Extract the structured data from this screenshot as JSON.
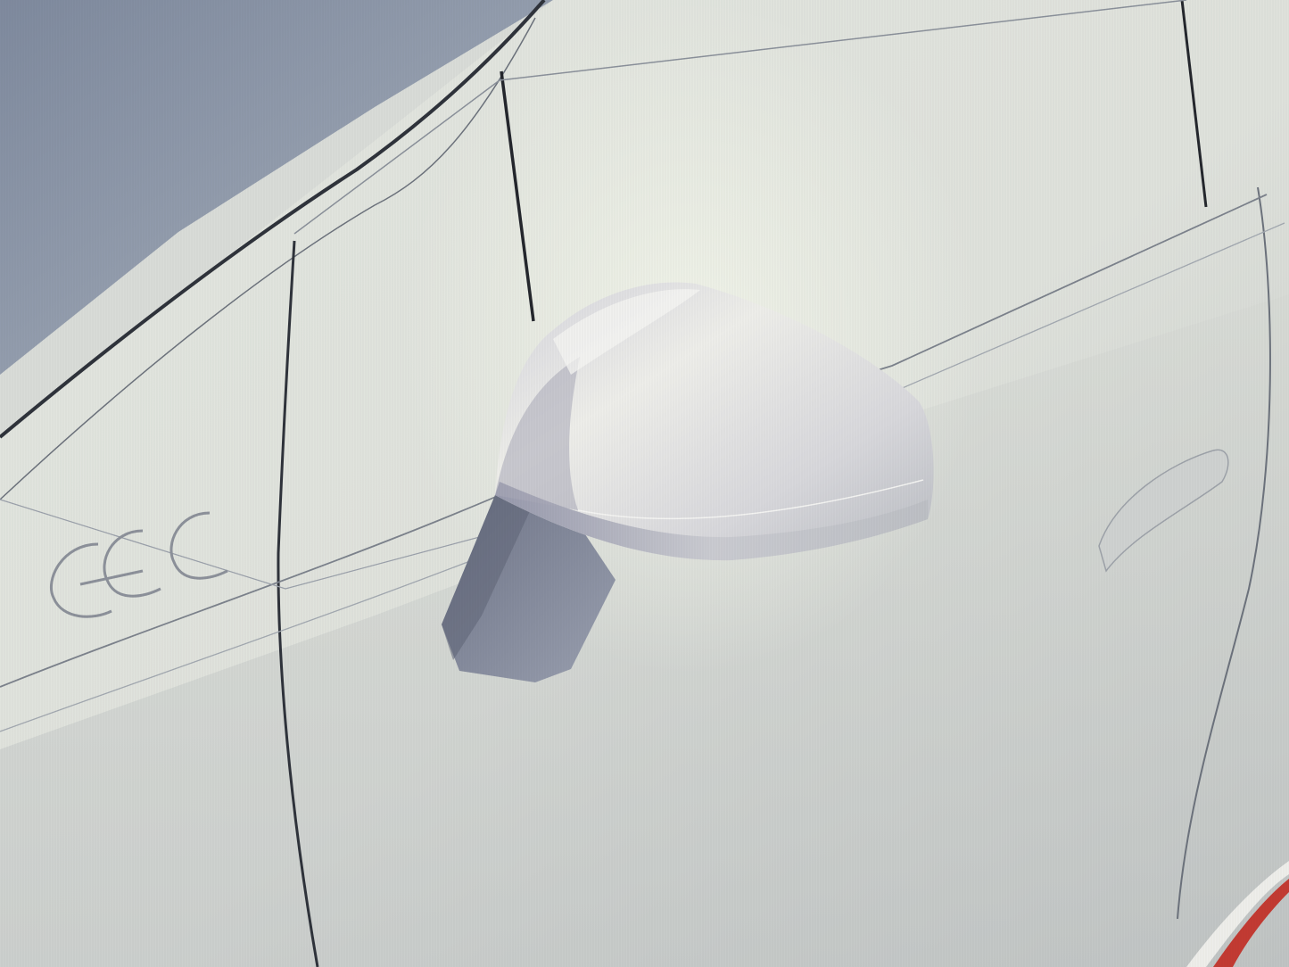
{
  "scene": {
    "subject": "car-side-mirror",
    "colors": {
      "sky": "#8a96a8",
      "body_light": "#e6e8e2",
      "body_mid": "#d3d6d0",
      "body_shadow": "#b4b7b6",
      "mirror_light": "#e9eae6",
      "mirror_shadow": "#a6a6b0",
      "mirror_base": "#7d8496",
      "line": "#3c4048",
      "accent_red": "#c33a32"
    }
  }
}
